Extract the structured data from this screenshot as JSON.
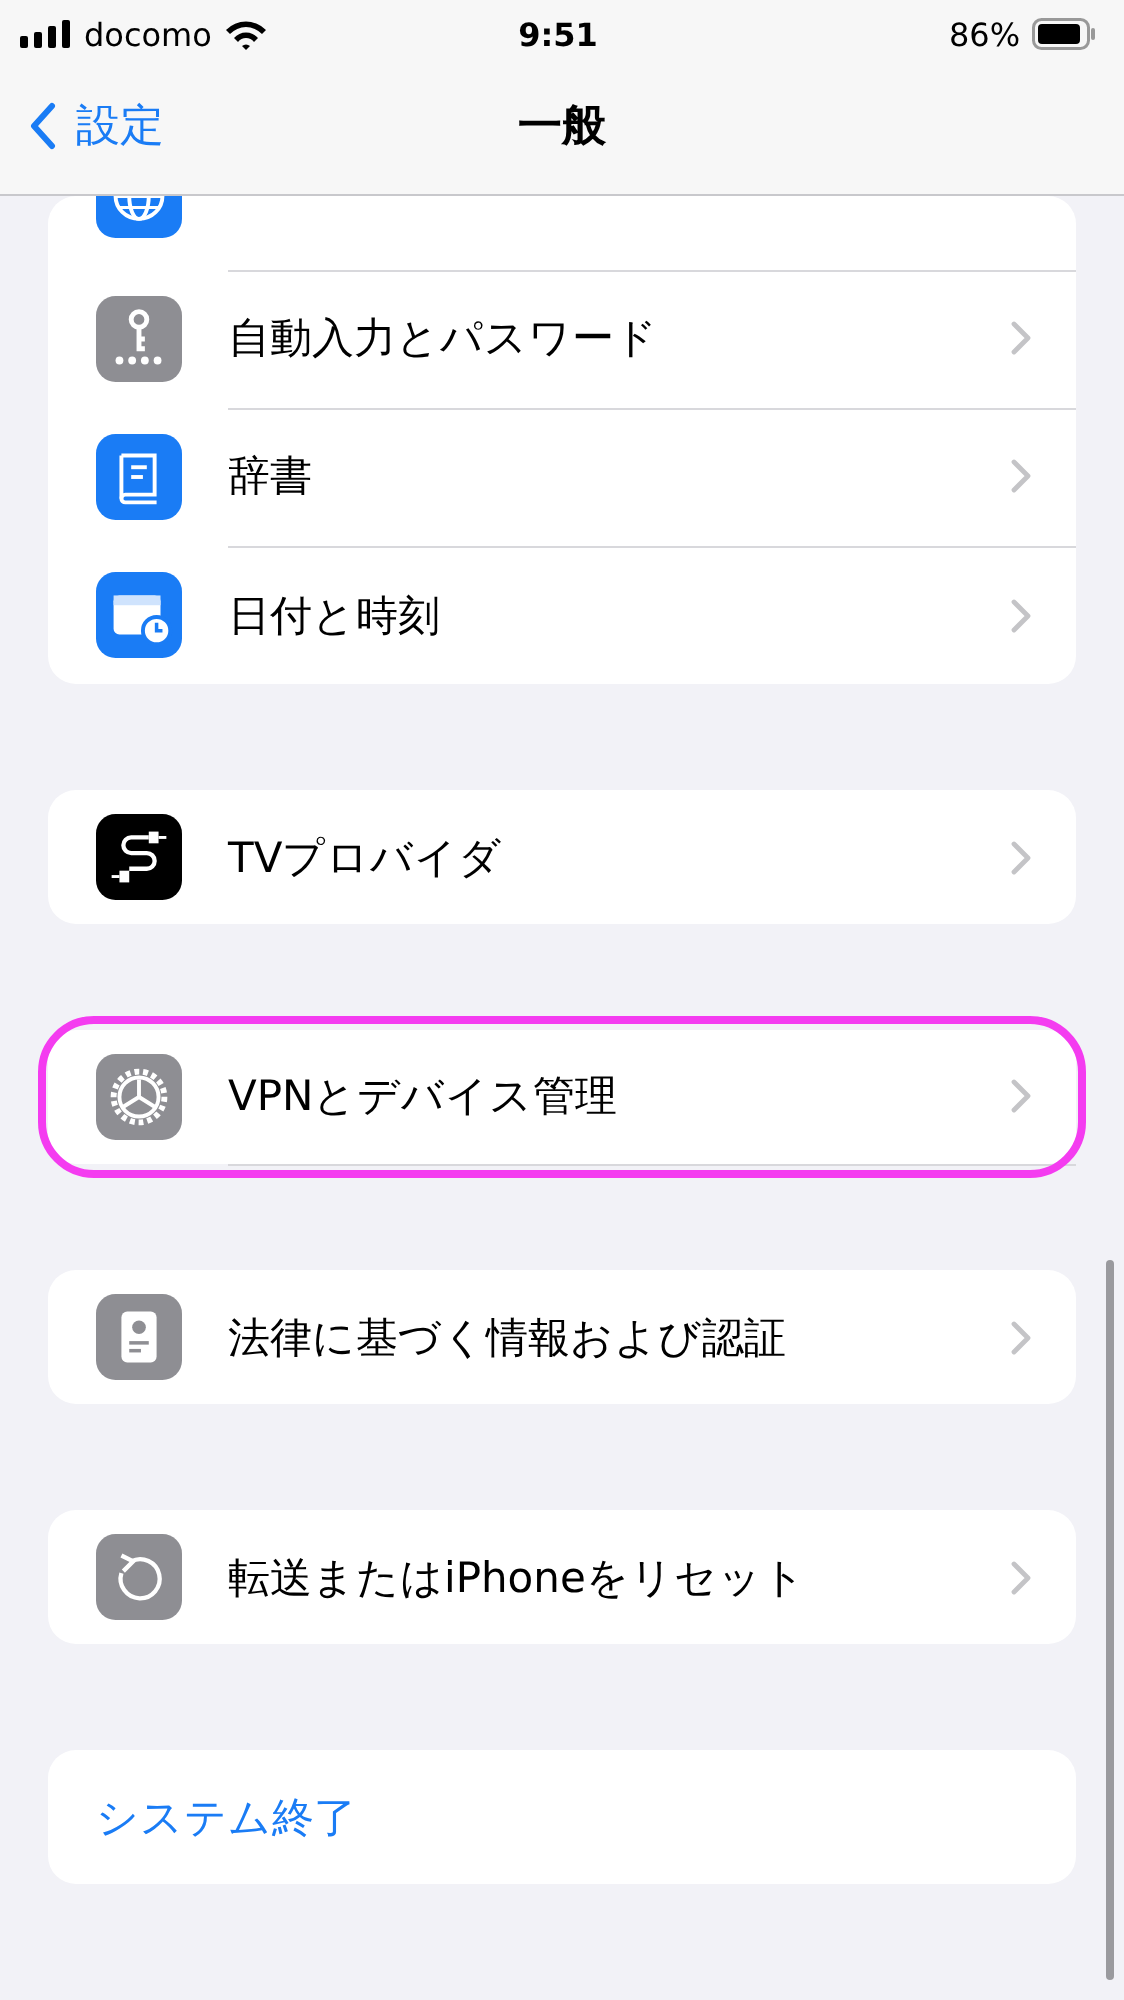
{
  "status_bar": {
    "carrier": "docomo",
    "time": "9:51",
    "battery": "86%"
  },
  "nav": {
    "back_label": "設定",
    "title": "一般"
  },
  "groups": [
    {
      "items": [
        {
          "kind": "partial"
        },
        {
          "kind": "link",
          "label": "自動入力とパスワード",
          "highlighted": false
        },
        {
          "kind": "link",
          "label": "辞書",
          "highlighted": false
        },
        {
          "kind": "link",
          "label": "日付と時刻",
          "highlighted": false
        }
      ]
    },
    {
      "items": [
        {
          "kind": "link",
          "label": "TVプロバイダ",
          "highlighted": false
        }
      ]
    },
    {
      "items": [
        {
          "kind": "link",
          "label": "VPNとデバイス管理",
          "highlighted": true
        }
      ]
    },
    {
      "items": [
        {
          "kind": "link",
          "label": "法律に基づく情報および認証",
          "highlighted": false
        }
      ]
    },
    {
      "items": [
        {
          "kind": "link",
          "label": "転送またはiPhoneをリセット",
          "highlighted": false
        }
      ]
    },
    {
      "items": [
        {
          "kind": "action",
          "label": "システム終了",
          "highlighted": false
        }
      ]
    }
  ]
}
